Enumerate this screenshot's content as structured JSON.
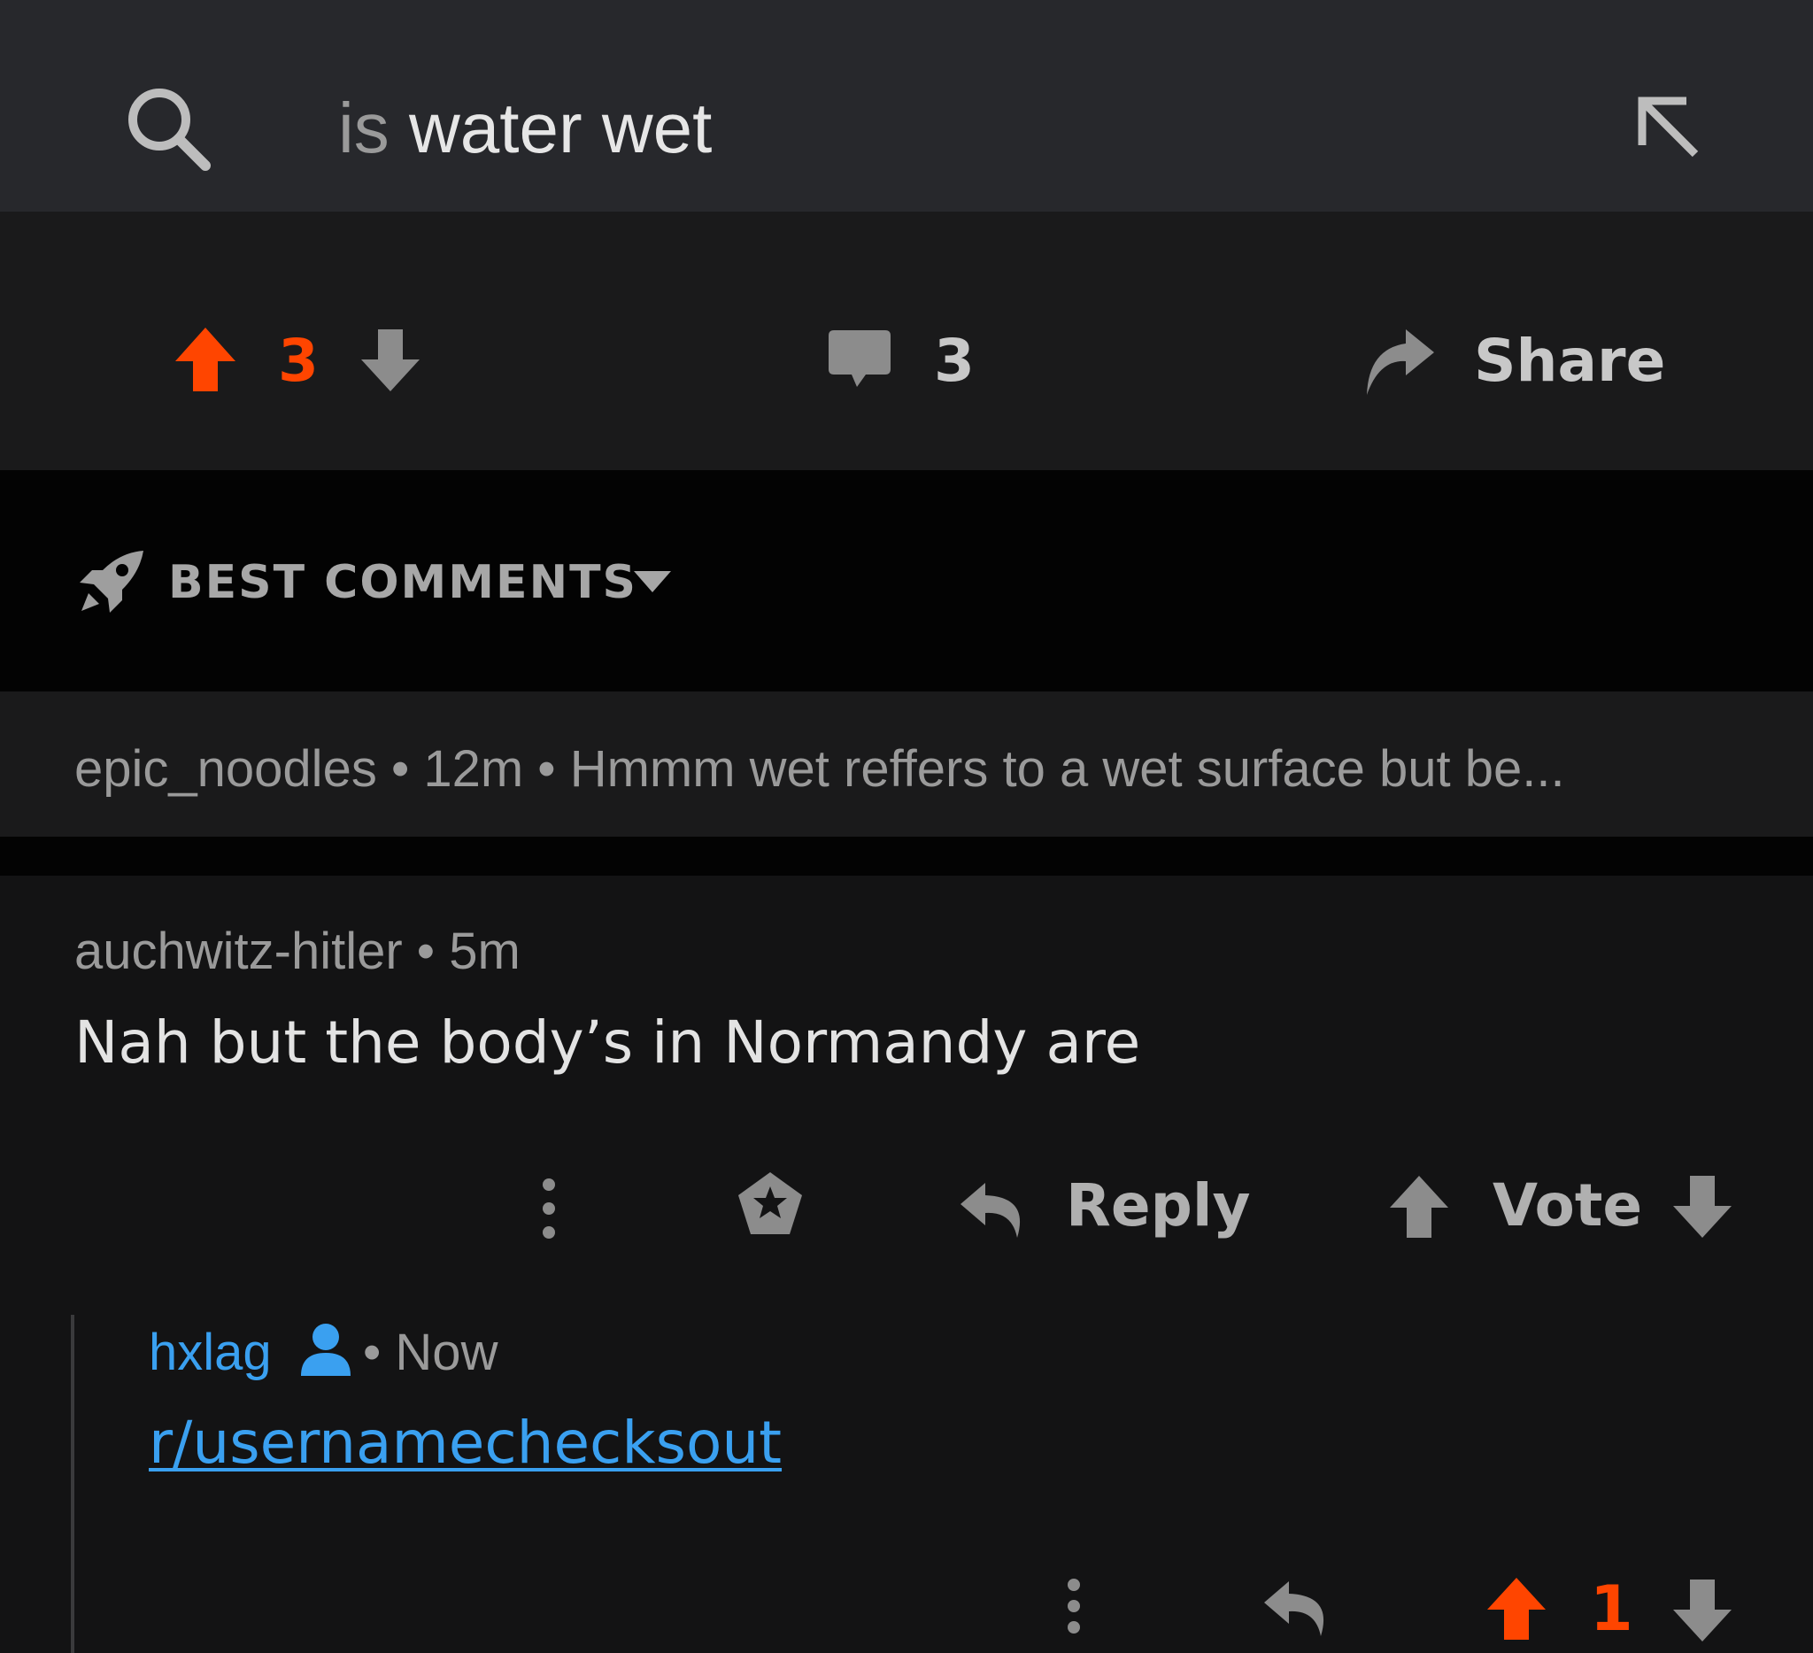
{
  "search": {
    "query_first": "is",
    "query_rest": " water wet"
  },
  "post": {
    "score": "3",
    "comments_count": "3",
    "share_label": "Share",
    "accent_color": "#ff4500"
  },
  "sort": {
    "label": "BEST COMMENTS"
  },
  "collapsed_comment": {
    "text": "epic_noodles • 12m • Hmmm wet reffers to a wet surface but be..."
  },
  "comment": {
    "author": "auchwitz-hitler",
    "sep": " • ",
    "time": "5m",
    "body": "Nah but the body’s in Normandy are",
    "reply_label": "Reply",
    "vote_label": "Vote"
  },
  "reply": {
    "author": "hxlag",
    "time": "• Now",
    "link": "r/usernamechecksout",
    "score": "1",
    "link_color": "#3aa0f0"
  },
  "icons": [
    "search-icon",
    "collapse-icon",
    "upvote-icon",
    "downvote-icon",
    "comment-icon",
    "share-icon",
    "rocket-icon",
    "caret-down-icon",
    "more-icon",
    "award-icon",
    "reply-icon",
    "user-icon"
  ]
}
